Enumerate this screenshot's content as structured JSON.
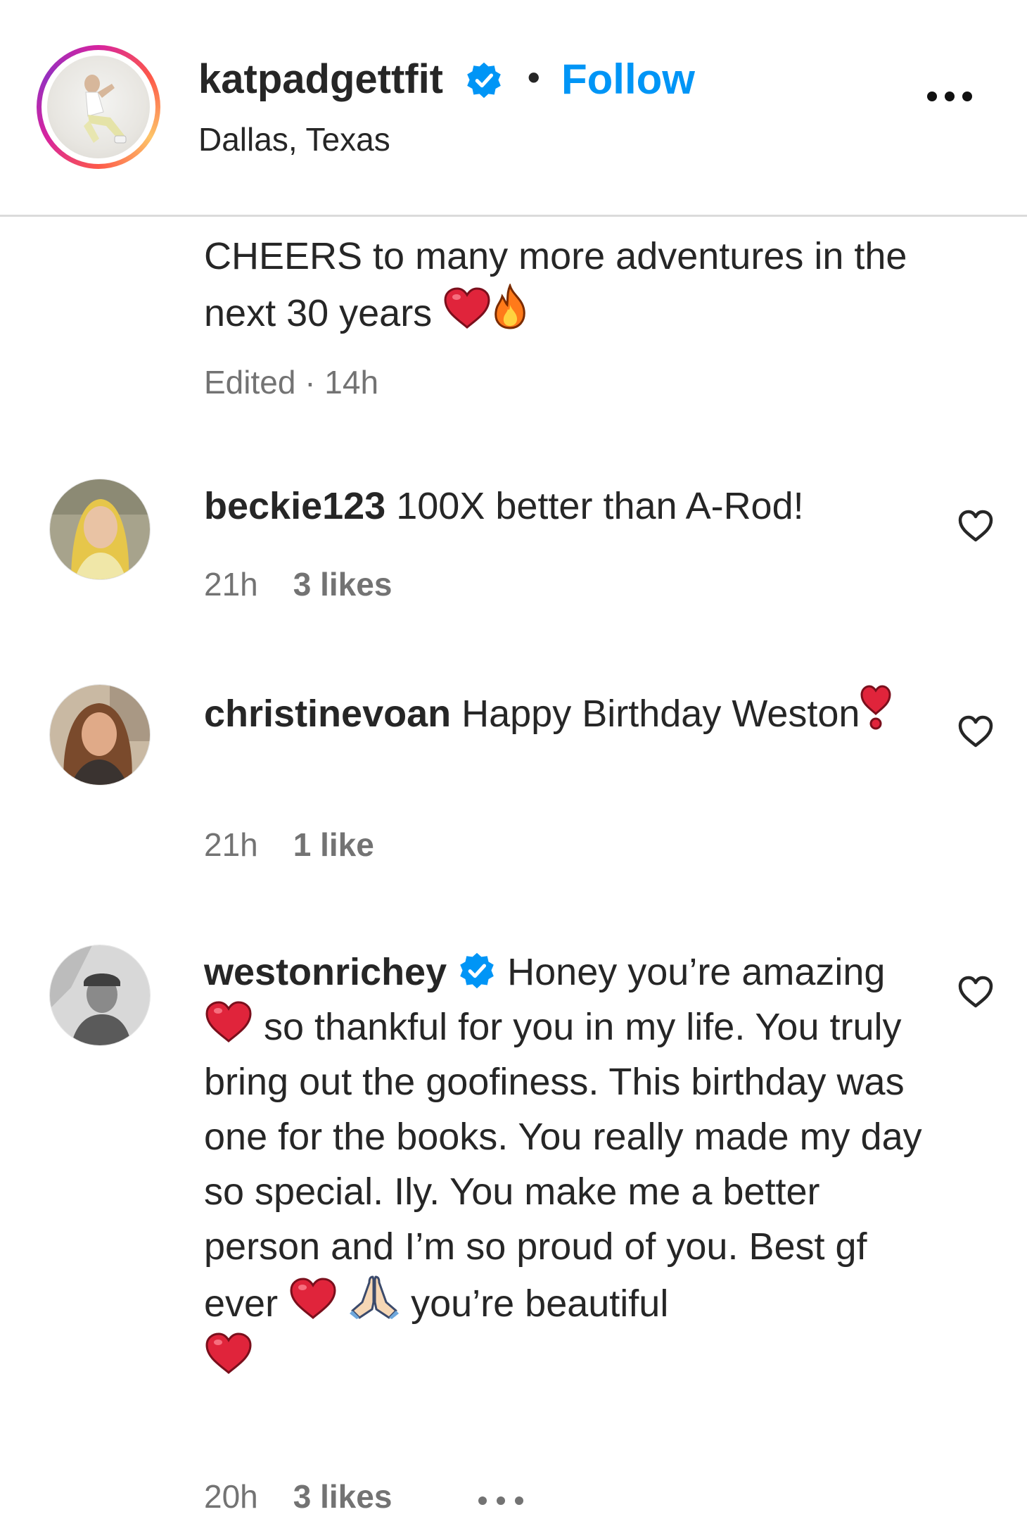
{
  "post_header": {
    "username": "katpadgettfit",
    "separator": "•",
    "follow_label": "Follow",
    "location": "Dallas, Texas",
    "avatar_icon": "profile-photo",
    "more_icon": "more-horizontal-icon"
  },
  "caption": {
    "text": "CHEERS to many more adventures in the next 30 years",
    "emojis": [
      "red-heart",
      "fire"
    ],
    "edited_label": "Edited · 14h"
  },
  "comments": [
    {
      "username": "beckie123",
      "text": "100X better than A-Rod!",
      "time": "21h",
      "likes": "3 likes",
      "verified": false
    },
    {
      "username": "christinevoan",
      "text": "Happy Birthday Weston",
      "emoji_after": "heavy-heart-exclamation",
      "time": "21h",
      "likes": "1 like",
      "verified": false
    },
    {
      "username": "westonrichey",
      "verified": true,
      "text_part1": "Honey you’re amazing",
      "text_part2": "so thankful for you in my life. You truly bring out the goofiness. This birthday was one for the books. You really made my day so special. Ily. You make me a better person and I’m so proud of you. Best gf ever",
      "text_part3": "you’re beautiful",
      "time": "20h",
      "likes": "3 likes"
    }
  ],
  "colors": {
    "accent_blue": "#0095f6",
    "text_primary": "#262626",
    "text_secondary": "#737373",
    "divider": "#dbdbdb",
    "heart_red": "#e0243b"
  }
}
